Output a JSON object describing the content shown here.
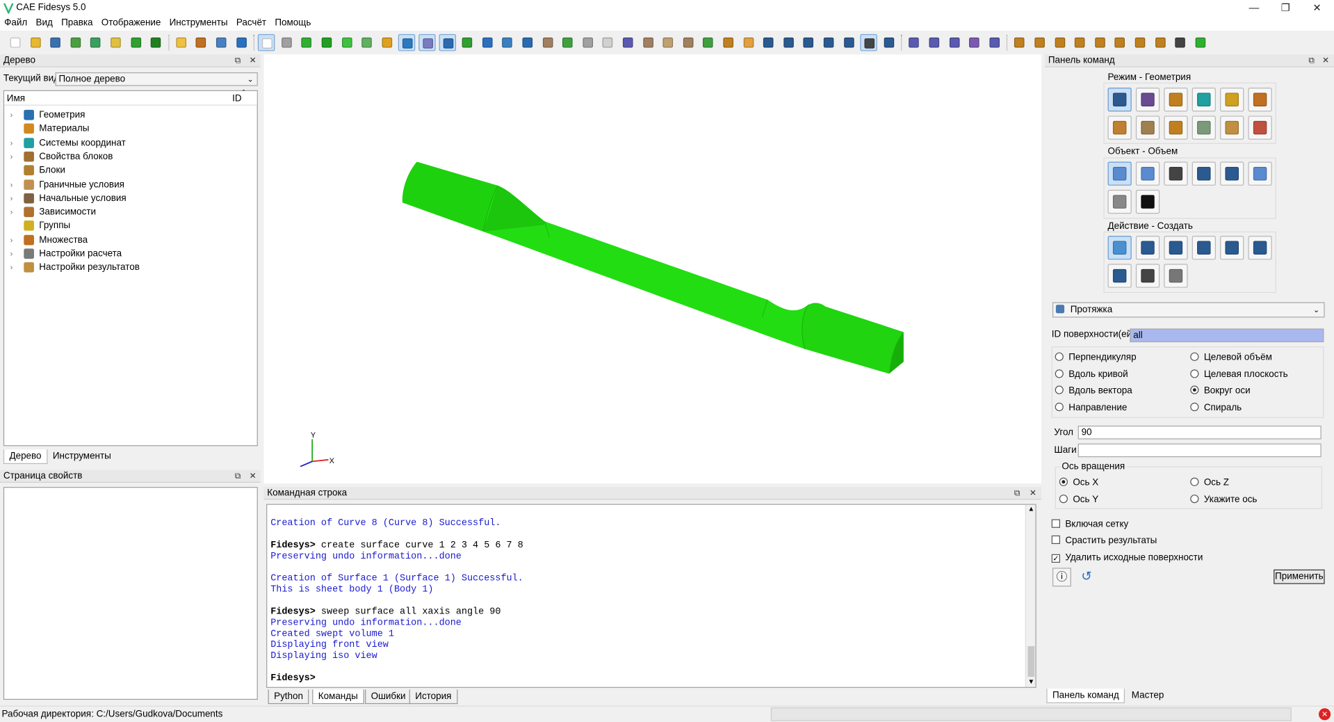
{
  "window": {
    "title": "CAE Fidesys 5.0",
    "minimize": "—",
    "restore": "❐",
    "close": "✕"
  },
  "menu": [
    "Файл",
    "Вид",
    "Правка",
    "Отображение",
    "Инструменты",
    "Расчёт",
    "Помощь"
  ],
  "tree_panel": {
    "title": "Дерево",
    "current_view_label": "Текущий вид",
    "current_view_value": "Полное дерево",
    "col_name": "Имя",
    "col_id": "ID",
    "items": [
      {
        "label": "Геометрия",
        "icon": "geometry-icon",
        "color": "#2a6fb0",
        "expandable": true
      },
      {
        "label": "Материалы",
        "icon": "materials-icon",
        "color": "#d08a20",
        "expandable": false
      },
      {
        "label": "Системы координат",
        "icon": "axes-icon",
        "color": "#20a0a0",
        "expandable": true
      },
      {
        "label": "Свойства блоков",
        "icon": "ibeam-icon",
        "color": "#a07030",
        "expandable": true
      },
      {
        "label": "Блоки",
        "icon": "block-icon",
        "color": "#b08030",
        "expandable": false
      },
      {
        "label": "Граничные условия",
        "icon": "bc-icon",
        "color": "#c09050",
        "expandable": true
      },
      {
        "label": "Начальные условия",
        "icon": "t0-icon",
        "color": "#806040",
        "expandable": true
      },
      {
        "label": "Зависимости",
        "icon": "graph-icon",
        "color": "#b07030",
        "expandable": true
      },
      {
        "label": "Группы",
        "icon": "groups-icon",
        "color": "#d0b020",
        "expandable": false
      },
      {
        "label": "Множества",
        "icon": "sets-icon",
        "color": "#c07020",
        "expandable": true
      },
      {
        "label": "Настройки расчета",
        "icon": "calc-settings-icon",
        "color": "#7a7a7a",
        "expandable": true
      },
      {
        "label": "Настройки результатов",
        "icon": "results-icon",
        "color": "#c09040",
        "expandable": true
      }
    ],
    "tabs": [
      "Дерево",
      "Инструменты"
    ]
  },
  "properties_panel": {
    "title": "Страница свойств"
  },
  "console": {
    "title": "Командная строка",
    "lines": [
      {
        "text": "Creation of Curve 8 (Curve 8) Successful.",
        "kind": "out"
      },
      {
        "text": "",
        "kind": "blank"
      },
      {
        "prompt": "Fidesys>",
        "text": " create surface curve 1 2 3 4 5 6 7 8",
        "kind": "cmd"
      },
      {
        "text": "Preserving undo information...done",
        "kind": "out"
      },
      {
        "text": "",
        "kind": "blank"
      },
      {
        "text": "Creation of Surface 1 (Surface 1) Successful.",
        "kind": "out"
      },
      {
        "text": "This is sheet body 1 (Body 1)",
        "kind": "out"
      },
      {
        "text": "",
        "kind": "blank"
      },
      {
        "prompt": "Fidesys>",
        "text": " sweep surface all xaxis angle 90",
        "kind": "cmd"
      },
      {
        "text": "Preserving undo information...done",
        "kind": "out"
      },
      {
        "text": "Created swept volume 1",
        "kind": "out"
      },
      {
        "text": "Displaying front view",
        "kind": "out"
      },
      {
        "text": "Displaying iso view",
        "kind": "out"
      },
      {
        "text": "",
        "kind": "blank"
      },
      {
        "prompt": "Fidesys>",
        "text": "",
        "kind": "cmd"
      }
    ],
    "tabs": [
      "Python",
      "Команды",
      "Ошибки",
      "История"
    ],
    "active_tab": "Команды"
  },
  "viewport": {
    "axis_x": "X",
    "axis_y": "Y",
    "model_color": "#22cc11"
  },
  "command_panel": {
    "title": "Панель команд",
    "mode_label": "Режим - Геометрия",
    "object_label": "Объект - Объем",
    "action_label": "Действие - Создать",
    "operation": "Протяжка",
    "surface_id_label": "ID поверхности(ей)",
    "surface_id_value": "all",
    "options_left": [
      "Перпендикуляр",
      "Вдоль кривой",
      "Вдоль вектора",
      "Направление"
    ],
    "options_right": [
      "Целевой объём",
      "Целевая плоскость",
      "Вокруг оси",
      "Спираль"
    ],
    "selected_option": "Вокруг оси",
    "angle_label": "Угол",
    "angle_value": "90",
    "steps_label": "Шаги",
    "steps_value": "",
    "axis_group_label": "Ось вращения",
    "axis_options": [
      "Ось X",
      "Ось Z",
      "Ось Y",
      "Укажите ось"
    ],
    "selected_axis": "Ось X",
    "checkbox_mesh": "Включая сетку",
    "checkbox_merge": "Срастить результаты",
    "checkbox_delete": "Удалить исходные поверхности",
    "checked": [
      "Удалить исходные поверхности"
    ],
    "apply_label": "Применить",
    "tabs": [
      "Панель команд",
      "Мастер"
    ]
  },
  "statusbar": {
    "workdir": "Рабочая директория: C:/Users/Gudkova/Documents"
  }
}
